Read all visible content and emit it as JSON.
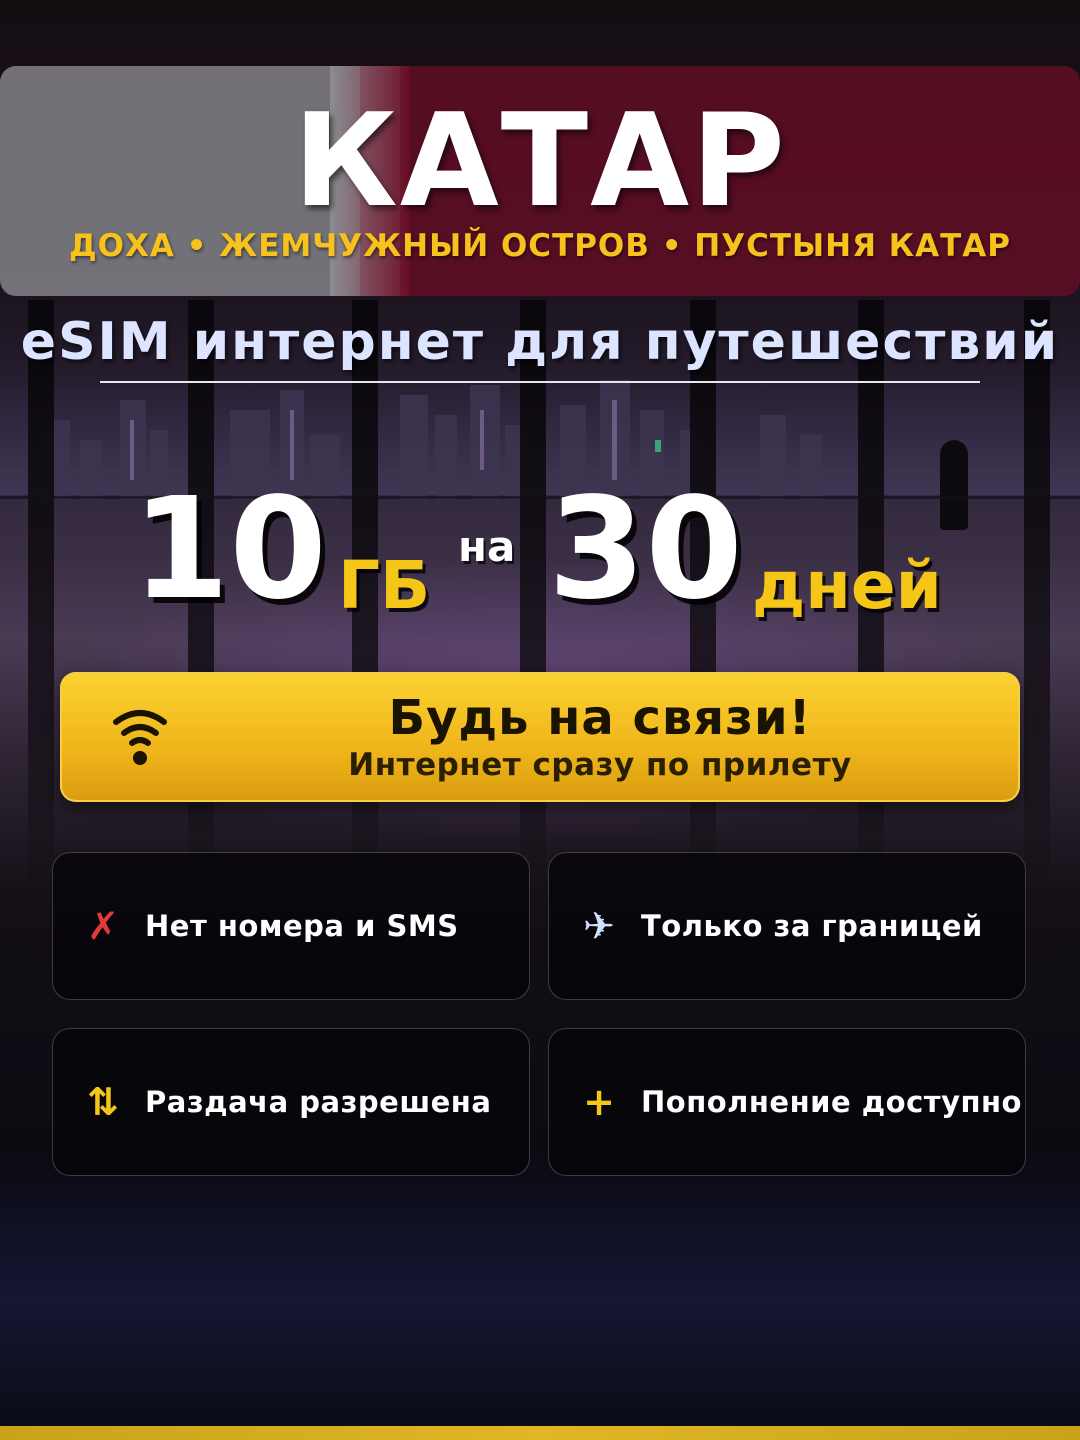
{
  "header": {
    "title": "КАТАР",
    "subtitle": "ДОХА • ЖЕМЧУЖНЫЙ ОСТРОВ • ПУСТЫНЯ КАТАР",
    "tagline": "eSIM интернет для путешествий"
  },
  "plan": {
    "data_amount": "10",
    "data_unit": "ГБ",
    "connector": "на",
    "duration": "30",
    "duration_unit": "дней"
  },
  "cta": {
    "icon": "wifi-icon",
    "title": "Будь на связи!",
    "subtitle": "Интернет сразу по прилету"
  },
  "features": [
    {
      "icon": "cross-icon",
      "label": "Нет номера и SMS",
      "icon_color": "#e03a3a"
    },
    {
      "icon": "airplane-icon",
      "label": "Только за границей",
      "icon_color": "#cfe0ff"
    },
    {
      "icon": "updown-arrows-icon",
      "label": "Раздача разрешена",
      "icon_color": "#f5c518"
    },
    {
      "icon": "plus-icon",
      "label": "Пополнение доступно",
      "icon_color": "#f5c518"
    }
  ],
  "colors": {
    "accent_yellow": "#f5c518",
    "flag_maroon": "#6e0c26",
    "tagline": "#dde4ff"
  }
}
